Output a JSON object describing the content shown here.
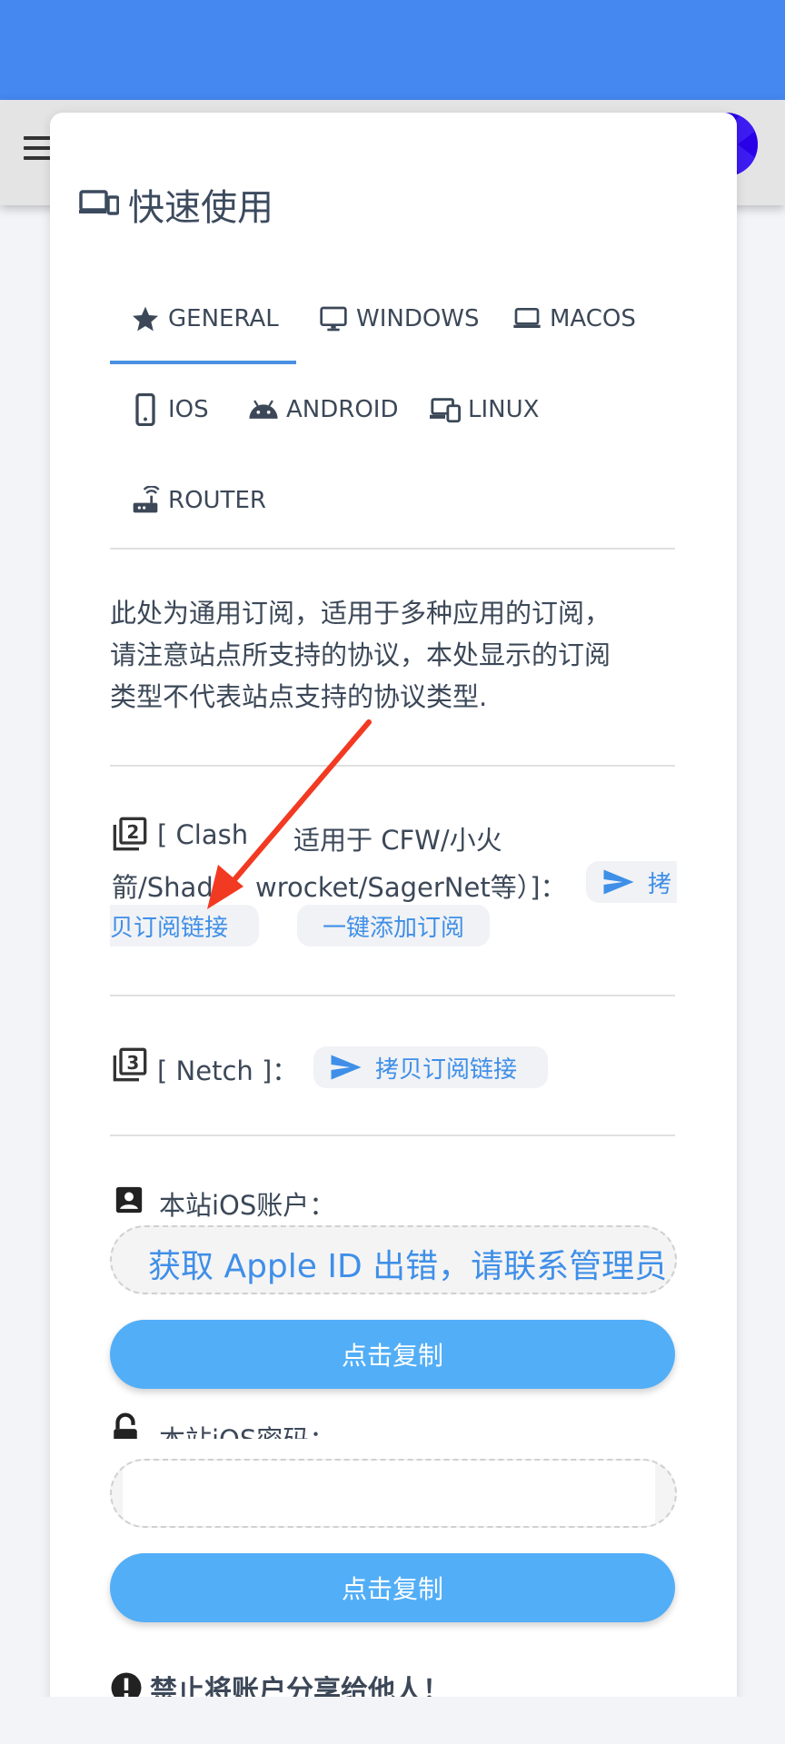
{
  "header": {
    "avatar_color": "#2a00e8"
  },
  "card": {
    "title": "快速使用"
  },
  "tabs": [
    {
      "label": "GENERAL",
      "icon": "star-icon",
      "selected": true
    },
    {
      "label": "WINDOWS",
      "icon": "monitor-icon"
    },
    {
      "label": "MACOS",
      "icon": "laptop-icon"
    },
    {
      "label": "IOS",
      "icon": "phone-icon"
    },
    {
      "label": "ANDROID",
      "icon": "android-icon"
    },
    {
      "label": "LINUX",
      "icon": "devices-icon"
    },
    {
      "label": "ROUTER",
      "icon": "router-icon"
    }
  ],
  "description": {
    "line1": "此处为通用订阅，适用于多种应用的订阅，",
    "line2": "请注意站点所支持的协议，本处显示的订阅",
    "line3": "类型不代表站点支持的协议类型."
  },
  "clash": {
    "line1_a": "[ Clash",
    "line1_b": "适用于 CFW/小火",
    "line2_a": "箭/Shad",
    "line2_b": "wrocket/SagerNet等）]：",
    "copy_label_a": "拷",
    "copy_label_b": "贝订阅链接",
    "add_label": "一键添加订阅"
  },
  "netch": {
    "label": "[ Netch ]：",
    "copy_label": "拷贝订阅链接"
  },
  "ios_account": {
    "label": "本站iOS账户：",
    "value": "获取 Apple ID 出错，请联系管理员",
    "copy_button": "点击复制"
  },
  "ios_password": {
    "label": "本站iOS密码：",
    "copy_button": "点击复制"
  },
  "warning": {
    "text": "禁止将账户分享给他人！"
  },
  "colors": {
    "accent": "#3f8fe8",
    "button": "#52aef7",
    "status_bar": "#4488f0",
    "annotation_arrow": "#f23a22"
  }
}
